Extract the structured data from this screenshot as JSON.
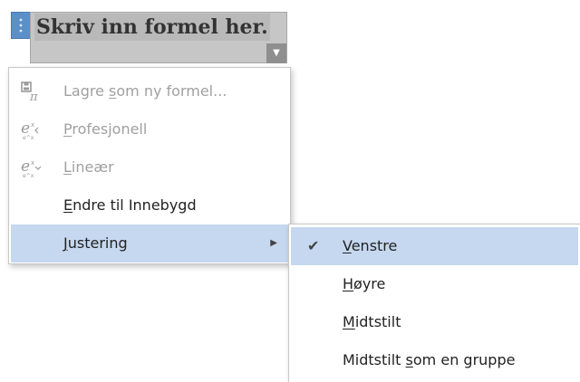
{
  "equation": {
    "placeholder_text": "Skriv inn formel her."
  },
  "menu": {
    "items": [
      {
        "pre": "Lagre ",
        "u": "s",
        "post": "om ny formel...",
        "icon": "save-formula-icon",
        "enabled": false
      },
      {
        "pre": "",
        "u": "P",
        "post": "rofesjonell",
        "icon": "professional-format-icon",
        "enabled": false
      },
      {
        "pre": "",
        "u": "L",
        "post": "ineær",
        "icon": "linear-format-icon",
        "enabled": false
      },
      {
        "pre": "",
        "u": "E",
        "post": "ndre til Innebygd",
        "icon": "",
        "enabled": true
      },
      {
        "pre": "",
        "u": "J",
        "post": "ustering",
        "icon": "",
        "enabled": true,
        "submenu": true
      }
    ]
  },
  "submenu": {
    "items": [
      {
        "pre": "",
        "u": "V",
        "post": "enstre",
        "checked": true
      },
      {
        "pre": "",
        "u": "H",
        "post": "øyre",
        "checked": false
      },
      {
        "pre": "",
        "u": "M",
        "post": "idtstilt",
        "checked": false
      },
      {
        "pre": "Midtstilt ",
        "u": "s",
        "post": "om en gruppe",
        "checked": false
      }
    ]
  },
  "icons": {
    "check": "✔",
    "submenu_arrow": "▶",
    "dropdown_arrow": "▼"
  },
  "colors": {
    "highlight": "#c5d8ef",
    "handle": "#5b8fc8",
    "disabled_text": "#a0a0a0"
  }
}
